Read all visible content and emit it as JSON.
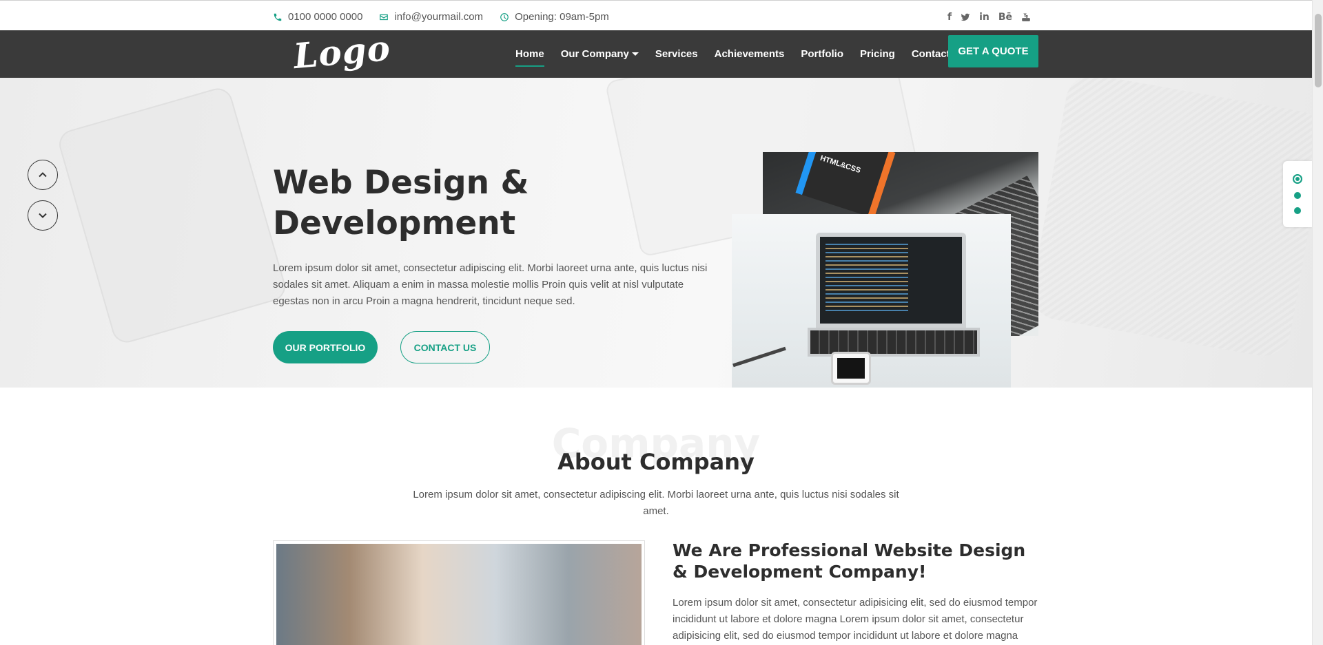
{
  "topbar": {
    "phone": "0100 0000 0000",
    "email": "info@yourmail.com",
    "hours": "Opening: 09am-5pm",
    "social": [
      "f",
      "twitter-icon",
      "in",
      "Bē",
      "youtube-icon"
    ]
  },
  "nav": {
    "logo": "Logo",
    "items": [
      "Home",
      "Our Company",
      "Services",
      "Achievements",
      "Portfolio",
      "Pricing",
      "Contact"
    ],
    "active": "Home",
    "cta": "GET A QUOTE"
  },
  "hero": {
    "title": "Web Design &\nDevelopment",
    "text": "Lorem ipsum dolor sit amet, consectetur adipiscing elit. Morbi laoreet urna ante, quis luctus nisi sodales sit amet. Aliquam a enim in massa molestie mollis Proin quis velit at nisl vulputate egestas non in arcu Proin a magna hendrerit, tincidunt neque sed.",
    "btn_portfolio": "OUR PORTFOLIO",
    "btn_contact": "CONTACT US",
    "book_label": "HTML&CSS",
    "slides": 3,
    "active_slide": 1
  },
  "about": {
    "bg_word": "Company",
    "title": "About Company",
    "desc": "Lorem ipsum dolor sit amet, consectetur adipiscing elit. Morbi laoreet urna ante, quis luctus nisi sodales sit amet.",
    "heading": "We Are Professional Website Design & Development Company!",
    "text": "Lorem ipsum dolor sit amet, consectetur adipisicing elit, sed do eiusmod tempor incididunt ut labore et dolore magna Lorem ipsum dolor sit amet, consectetur adipisicing elit, sed do eiusmod tempor incididunt ut labore et dolore magna"
  },
  "colors": {
    "accent": "#16a085",
    "nav_bg": "#3a3a3a",
    "heading": "#2d2d2d"
  }
}
